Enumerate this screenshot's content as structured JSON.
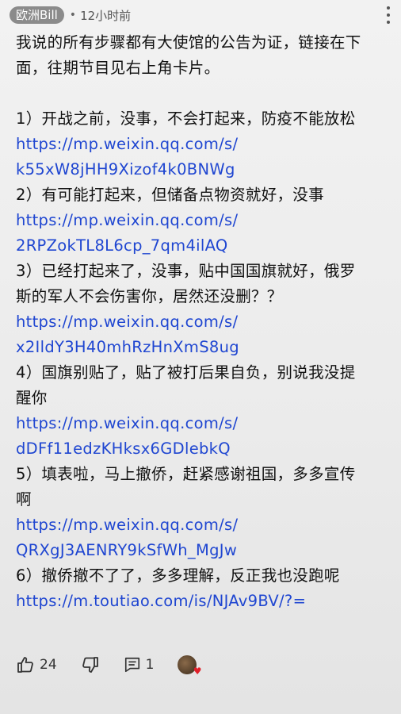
{
  "comment": {
    "author": "欧洲Bill",
    "dot": "•",
    "time": "12小时前",
    "lines": [
      {
        "text": "我说的所有步骤都有大使馆的公告为证，链接在下",
        "link": false
      },
      {
        "text": "面，往期节目见右上角卡片。",
        "link": false
      },
      {
        "text": "",
        "link": false
      },
      {
        "text": "1）开战之前，没事，不会打起来，防疫不能放松",
        "link": false
      },
      {
        "text": "https://mp.weixin.qq.com/s/",
        "link": true
      },
      {
        "text": "k55xW8jHH9Xizof4k0BNWg",
        "link": true
      },
      {
        "text": "2）有可能打起来，但储备点物资就好，没事",
        "link": false
      },
      {
        "text": "https://mp.weixin.qq.com/s/",
        "link": true
      },
      {
        "text": "2RPZokTL8L6cp_7qm4ilAQ",
        "link": true
      },
      {
        "text": "3）已经打起来了，没事，贴中国国旗就好，俄罗",
        "link": false
      },
      {
        "text": "斯的军人不会伤害你，居然还没删？？",
        "link": false
      },
      {
        "text": "https://mp.weixin.qq.com/s/",
        "link": true
      },
      {
        "text": "x2IldY3H40mhRzHnXmS8ug",
        "link": true
      },
      {
        "text": "4）国旗别贴了，贴了被打后果自负，别说我没提",
        "link": false
      },
      {
        "text": "醒你",
        "link": false
      },
      {
        "text": "https://mp.weixin.qq.com/s/",
        "link": true
      },
      {
        "text": "dDFf11edzKHksx6GDlebkQ",
        "link": true
      },
      {
        "text": "5）填表啦，马上撤侨，赶紧感谢祖国，多多宣传",
        "link": false
      },
      {
        "text": "啊",
        "link": false
      },
      {
        "text": "https://mp.weixin.qq.com/s/",
        "link": true
      },
      {
        "text": "QRXgJ3AENRY9kSfWh_MgJw",
        "link": true
      },
      {
        "text": "6）撤侨撤不了了，多多理解，反正我也没跑呢",
        "link": false
      },
      {
        "text": "https://m.toutiao.com/is/NJAv9BV/?=",
        "link": true
      }
    ]
  },
  "actions": {
    "like_count": "24",
    "reply_count": "1"
  },
  "icons": {
    "like": "thumbs-up-icon",
    "dislike": "thumbs-down-icon",
    "reply": "comment-icon",
    "more": "more-vertical-icon",
    "heart": "heart-icon"
  },
  "colors": {
    "link": "#1f46d1",
    "author_chip": "#8b8b8b",
    "heart": "#e0202a"
  }
}
